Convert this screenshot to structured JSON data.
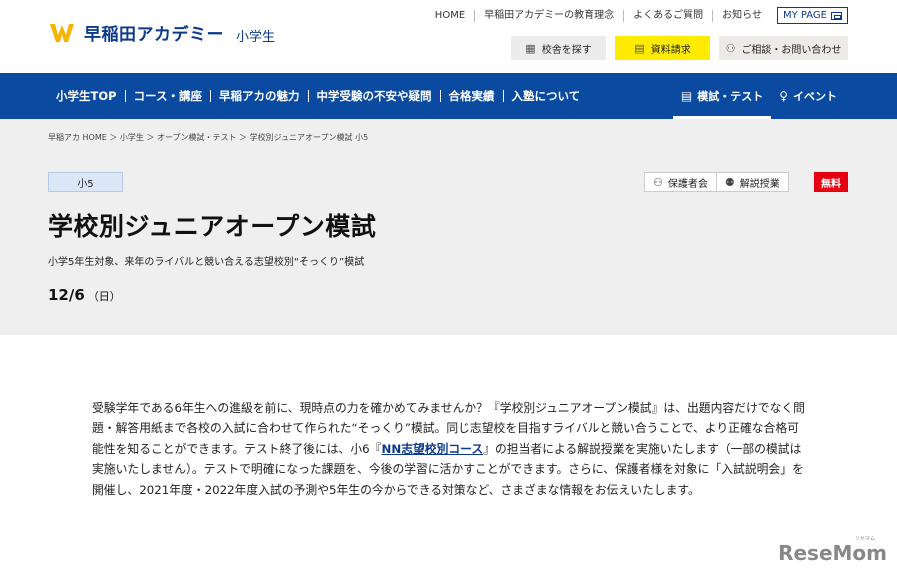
{
  "header": {
    "logo_text": "早稲田アカデミー",
    "logo_sub": "小学生",
    "util_links": [
      "HOME",
      "早稲田アカデミーの教育理念",
      "よくあるご質問",
      "お知らせ"
    ],
    "mypage_label": "MY PAGE",
    "buttons": {
      "school": "校舎を探す",
      "request": "資料請求",
      "consult": "ご相談・お問い合わせ"
    }
  },
  "nav": {
    "items": [
      "小学生TOP",
      "コース・講座",
      "早稲アカの魅力",
      "中学受験の不安や疑問",
      "合格実績",
      "入塾について"
    ],
    "right": {
      "exam": "模試・テスト",
      "event": "イベント"
    }
  },
  "hero": {
    "breadcrumb": "早稲アカ HOME ＞ 小学生 ＞ オープン模試・テスト ＞ 学校別ジュニアオープン模試 小5",
    "grade": "小5",
    "tags": {
      "parents": "保護者会",
      "lecture": "解説授業"
    },
    "free": "無料",
    "title": "学校別ジュニアオープン模試",
    "subtitle": "小学5年生対象、来年のライバルと競い合える志望校別“そっくり”模試",
    "date": "12/6",
    "day_of_week": "（日）"
  },
  "content": {
    "part1": "受験学年である6年生への進級を前に、現時点の力を確かめてみませんか？『学校別ジュニアオープン模試』は、出題内容だけでなく問題・解答用紙まで各校の入試に合わせて作られた“そっくり”模試。同じ志望校を目指すライバルと競い合うことで、より正確な合格可能性を知ることができます。テスト終了後には、小6『",
    "link": "NN志望校別コース",
    "part2": "』の担当者による解説授業を実施いたします（一部の模試は実施いたしません）。テストで明確になった課題を、今後の学習に活かすことができます。さらに、保護者様を対象に「入試説明会」を開催し、2021年度・2022年度入試の予測や5年生の今からできる対策など、さまざまな情報をお伝えいたします。"
  },
  "watermark": {
    "text": "ReseMom",
    "small": "リセマム"
  },
  "colors": {
    "brand_blue": "#0b4aa1",
    "logo_yellow": "#f5b400",
    "request_yellow": "#ffeb00",
    "free_red": "#e60012"
  }
}
